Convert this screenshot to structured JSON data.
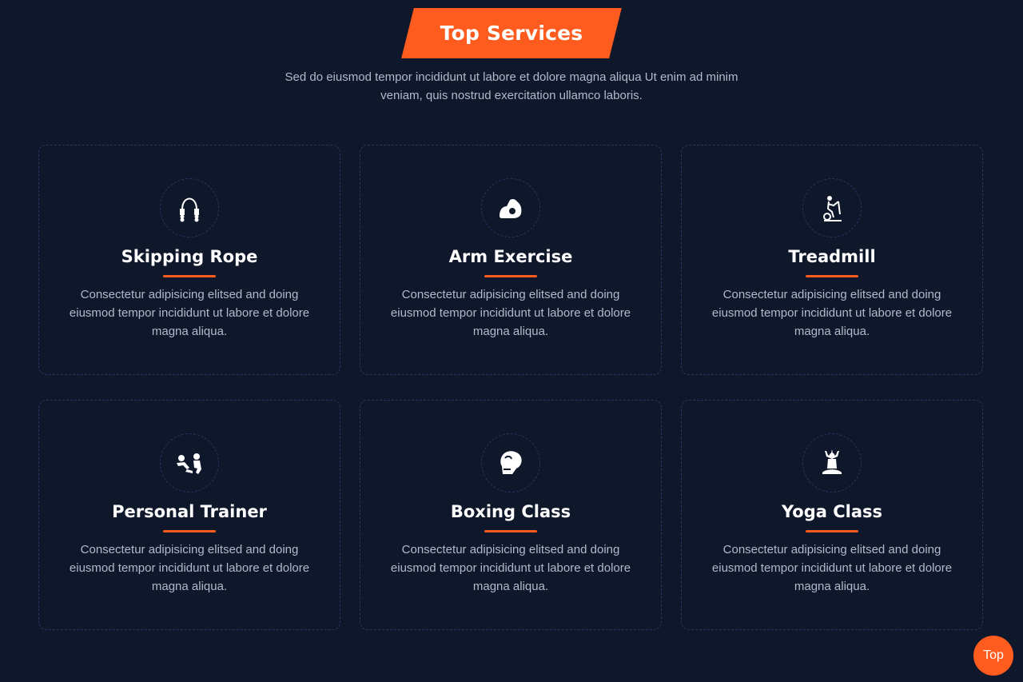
{
  "header": {
    "title": "Top Services",
    "intro": "Sed do eiusmod tempor incididunt ut labore et dolore magna aliqua Ut enim ad minim veniam, quis nostrud exercitation ullamco laboris."
  },
  "colors": {
    "background": "#0f172b",
    "accent": "#fd5c1e",
    "muted_text": "#b2b9cc",
    "dashed_border": "#2a3560"
  },
  "services": [
    {
      "title": "Skipping Rope",
      "icon": "skipping-rope-icon",
      "description": "Consectetur adipisicing elitsed and doing eiusmod tempor incididunt ut labore et dolore magna aliqua."
    },
    {
      "title": "Arm Exercise",
      "icon": "arm-muscle-icon",
      "description": "Consectetur adipisicing elitsed and doing eiusmod tempor incididunt ut labore et dolore magna aliqua."
    },
    {
      "title": "Treadmill",
      "icon": "treadmill-icon",
      "description": "Consectetur adipisicing elitsed and doing eiusmod tempor incididunt ut labore et dolore magna aliqua."
    },
    {
      "title": "Personal Trainer",
      "icon": "personal-trainer-icon",
      "description": "Consectetur adipisicing elitsed and doing eiusmod tempor incididunt ut labore et dolore magna aliqua."
    },
    {
      "title": "Boxing Class",
      "icon": "boxing-glove-icon",
      "description": "Consectetur adipisicing elitsed and doing eiusmod tempor incididunt ut labore et dolore magna aliqua."
    },
    {
      "title": "Yoga Class",
      "icon": "yoga-pose-icon",
      "description": "Consectetur adipisicing elitsed and doing eiusmod tempor incididunt ut labore et dolore magna aliqua."
    }
  ],
  "scroll_top": {
    "label": "Top"
  }
}
